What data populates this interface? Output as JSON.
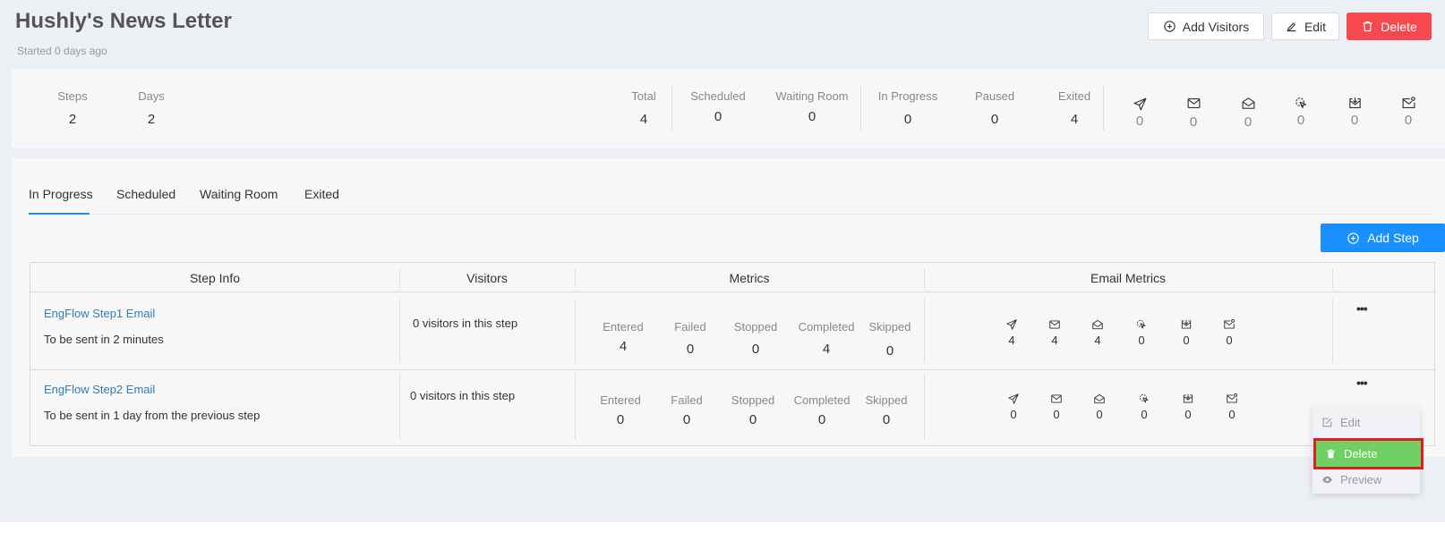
{
  "header": {
    "title": "Hushly's News Letter",
    "subtitle": "Started 0 days ago",
    "add_visitors_label": "Add Visitors",
    "edit_label": "Edit",
    "delete_label": "Delete"
  },
  "stats": {
    "steps": {
      "label": "Steps",
      "value": "2"
    },
    "days": {
      "label": "Days",
      "value": "2"
    },
    "total": {
      "label": "Total",
      "value": "4"
    },
    "scheduled": {
      "label": "Scheduled",
      "value": "0"
    },
    "waiting_room": {
      "label": "Waiting Room",
      "value": "0"
    },
    "in_progress": {
      "label": "In Progress",
      "value": "0"
    },
    "paused": {
      "label": "Paused",
      "value": "0"
    },
    "exited": {
      "label": "Exited",
      "value": "4"
    },
    "email_icons": [
      {
        "icon": "send-icon",
        "value": "0"
      },
      {
        "icon": "mail-icon",
        "value": "0"
      },
      {
        "icon": "mail-open-icon",
        "value": "0"
      },
      {
        "icon": "click-icon",
        "value": "0"
      },
      {
        "icon": "mail-download-icon",
        "value": "0"
      },
      {
        "icon": "mail-badge-icon",
        "value": "0"
      }
    ]
  },
  "tabs": [
    "In Progress",
    "Scheduled",
    "Waiting Room",
    "Exited"
  ],
  "add_step_label": "Add Step",
  "table": {
    "headers": [
      "Step Info",
      "Visitors",
      "Metrics",
      "Email Metrics"
    ],
    "metric_labels": [
      "Entered",
      "Failed",
      "Stopped",
      "Completed",
      "Skipped"
    ],
    "rows": [
      {
        "name": "EngFlow Step1 Email",
        "when": "To be sent in 2 minutes",
        "visitors": "0 visitors in this step",
        "metrics": [
          "4",
          "0",
          "0",
          "4",
          "0"
        ],
        "email_metrics": [
          "4",
          "4",
          "4",
          "0",
          "0",
          "0"
        ]
      },
      {
        "name": "EngFlow Step2 Email",
        "when": "To be sent in 1 day from the previous step",
        "visitors": "0 visitors in this step",
        "metrics": [
          "0",
          "0",
          "0",
          "0",
          "0"
        ],
        "email_metrics": [
          "0",
          "0",
          "0",
          "0",
          "0",
          "0"
        ]
      }
    ]
  },
  "row_menu": {
    "edit_label": "Edit",
    "delete_label": "Delete",
    "preview_label": "Preview"
  },
  "colors": {
    "primary": "#1890ff",
    "danger": "#f5484f",
    "link": "#2f7fb8",
    "menu_highlight": "#6fd164",
    "highlight_border": "#e01b22"
  }
}
